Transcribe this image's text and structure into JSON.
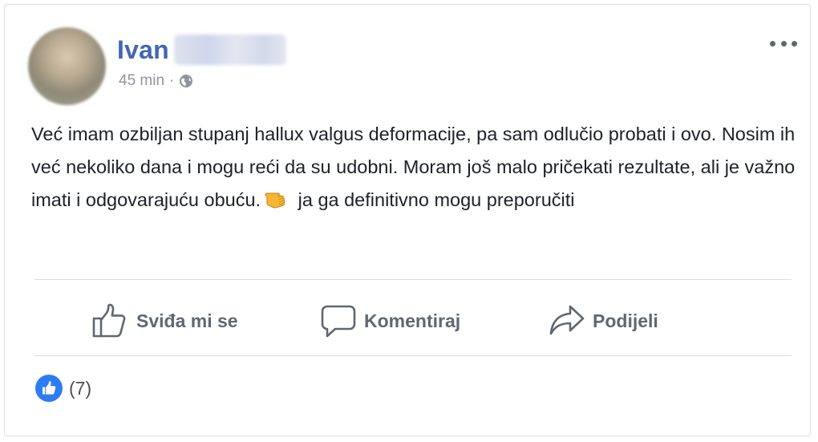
{
  "post": {
    "author_name": "Ivan",
    "timestamp": "45 min",
    "meta_separator": "·",
    "privacy_icon": "globe-icon",
    "body_before_emoji": "Već imam ozbiljan stupanj hallux valgus deformacije, pa sam odlučio probati i ovo. Nosim ih već nekoliko dana i mogu reći da su udobni. Moram još malo pričekati rezultate, ali je važno imati i odgovarajuću obuću.",
    "emoji": "thumbs-up-emoji",
    "body_after_emoji": " ja ga definitivno mogu preporučiti"
  },
  "actions": {
    "like_label": "Sviđa mi se",
    "comment_label": "Komentiraj",
    "share_label": "Podijeli"
  },
  "reactions": {
    "icon": "like-icon",
    "count_text": "(7)"
  },
  "colors": {
    "author": "#4267b2",
    "meta": "#90949c",
    "action_text": "#606770",
    "like_badge": "#2e7bf6",
    "divider": "#dadde1"
  }
}
